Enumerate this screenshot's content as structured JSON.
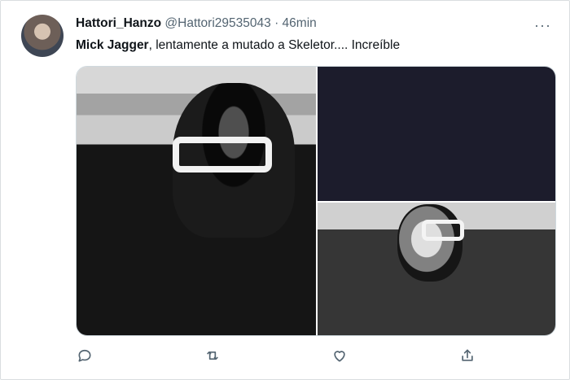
{
  "author": {
    "display_name": "Hattori_Hanzo",
    "handle": "@Hattori29535043",
    "separator": "·",
    "time": "46min"
  },
  "tweet": {
    "mention": "Mick Jagger",
    "body": ", lentamente a mutado a Skeletor.... Increíble"
  },
  "menu": {
    "more": "···"
  },
  "icons": {
    "avatar": "avatar-icon",
    "reply": "reply-icon",
    "retweet": "retweet-icon",
    "like": "like-icon",
    "share": "share-icon"
  },
  "colors": {
    "text": "#0f1419",
    "muted": "#536471",
    "dark_panel": "#1c1c2c"
  }
}
